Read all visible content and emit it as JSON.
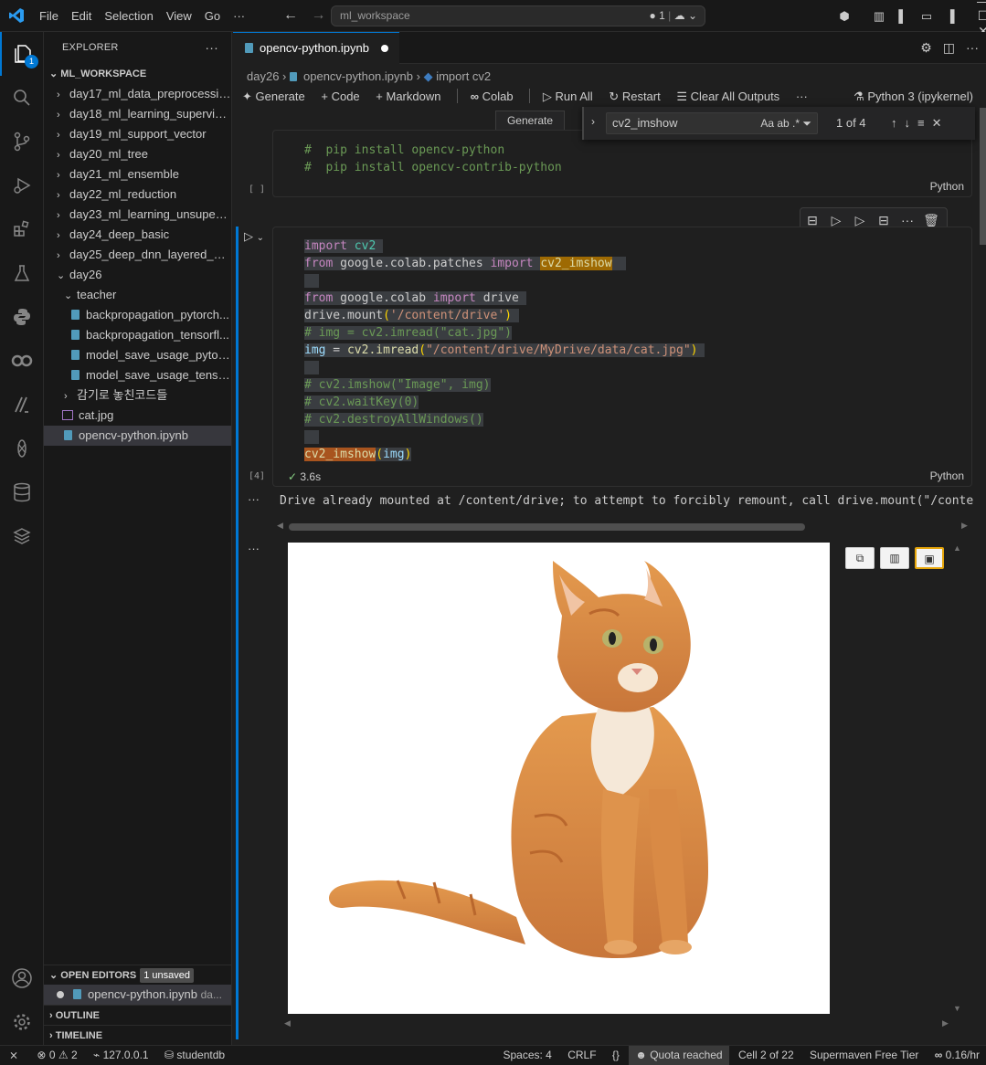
{
  "menu": [
    "File",
    "Edit",
    "Selection",
    "View",
    "Go"
  ],
  "titlebar": {
    "more": "···",
    "search": "ml_workspace",
    "indicator": "● 1"
  },
  "explorer": {
    "header": "EXPLORER",
    "root": "ML_WORKSPACE",
    "folders": [
      "day17_ml_data_preprocessing",
      "day18_ml_learning_supervise...",
      "day19_ml_support_vector",
      "day20_ml_tree",
      "day21_ml_ensemble",
      "day22_ml_reduction",
      "day23_ml_learning_unsuperv...",
      "day24_deep_basic",
      "day25_deep_dnn_layered_str..."
    ],
    "open_folder": "day26",
    "subfolder": "teacher",
    "teacher_files": [
      "backpropagation_pytorch...",
      "backpropagation_tensorfl...",
      "model_save_usage_pytorc...",
      "model_save_usage_tensor..."
    ],
    "korean_folder": "감기로 놓친코드들",
    "image_file": "cat.jpg",
    "notebook_file": "opencv-python.ipynb",
    "open_editors": "OPEN EDITORS",
    "unsaved": "1 unsaved",
    "open_editor_file": "opencv-python.ipynb",
    "open_editor_dir": "da...",
    "outline": "OUTLINE",
    "timeline": "TIMELINE"
  },
  "activity_badge": "1",
  "tab": {
    "label": "opencv-python.ipynb"
  },
  "breadcrumb": {
    "folder": "day26",
    "file": "opencv-python.ipynb",
    "symbol": "import cv2"
  },
  "toolbar": {
    "generate": "Generate",
    "code": "Code",
    "markdown": "Markdown",
    "colab": "Colab",
    "run_all": "Run All",
    "restart": "Restart",
    "clear": "Clear All Outputs",
    "more": "···",
    "kernel": "Python 3 (ipykernel)"
  },
  "generate_button": "Generate",
  "find": {
    "query": "cv2_imshow",
    "count": "1 of 4",
    "opts": "Aa  ab  .*"
  },
  "cell1": {
    "lines": [
      "#  pip install opencv-python",
      "#  pip install opencv-contrib-python"
    ],
    "exec": "[ ]",
    "lang": "Python"
  },
  "cell2": {
    "exec": "[4]",
    "time": "3.6s",
    "lang": "Python",
    "line_import": "cv2",
    "line_from": "google.colab.patches",
    "line_match": "cv2_imshow",
    "line_from2": "google.colab",
    "line_drive": "drive",
    "line_mount_fn": "drive.mount",
    "line_mount_arg": "'/content/drive'",
    "line_comment1": "# img = cv2.imread(\"cat.jpg\")",
    "line_img": "img",
    "line_imread": "cv2.imread",
    "line_path": "\"/content/drive/MyDrive/data/cat.jpg\"",
    "line_c1": "# cv2.imshow(\"Image\", img)",
    "line_c2": "# cv2.waitKey(0)",
    "line_c3": "# cv2.destroyAllWindows()",
    "line_call": "cv2_imshow",
    "line_call_arg": "img"
  },
  "output": {
    "text": "Drive already mounted at /content/drive; to attempt to forcibly remount, call drive.mount(\"/content",
    "more": "···"
  },
  "status": {
    "errors": "0",
    "warnings": "2",
    "host": "127.0.0.1",
    "db": "studentdb",
    "spaces": "Spaces: 4",
    "eol": "CRLF",
    "braces": "{}",
    "quota": "Quota reached",
    "cell": "Cell 2 of 22",
    "supermaven": "Supermaven Free Tier",
    "rate": "0.16/hr"
  }
}
